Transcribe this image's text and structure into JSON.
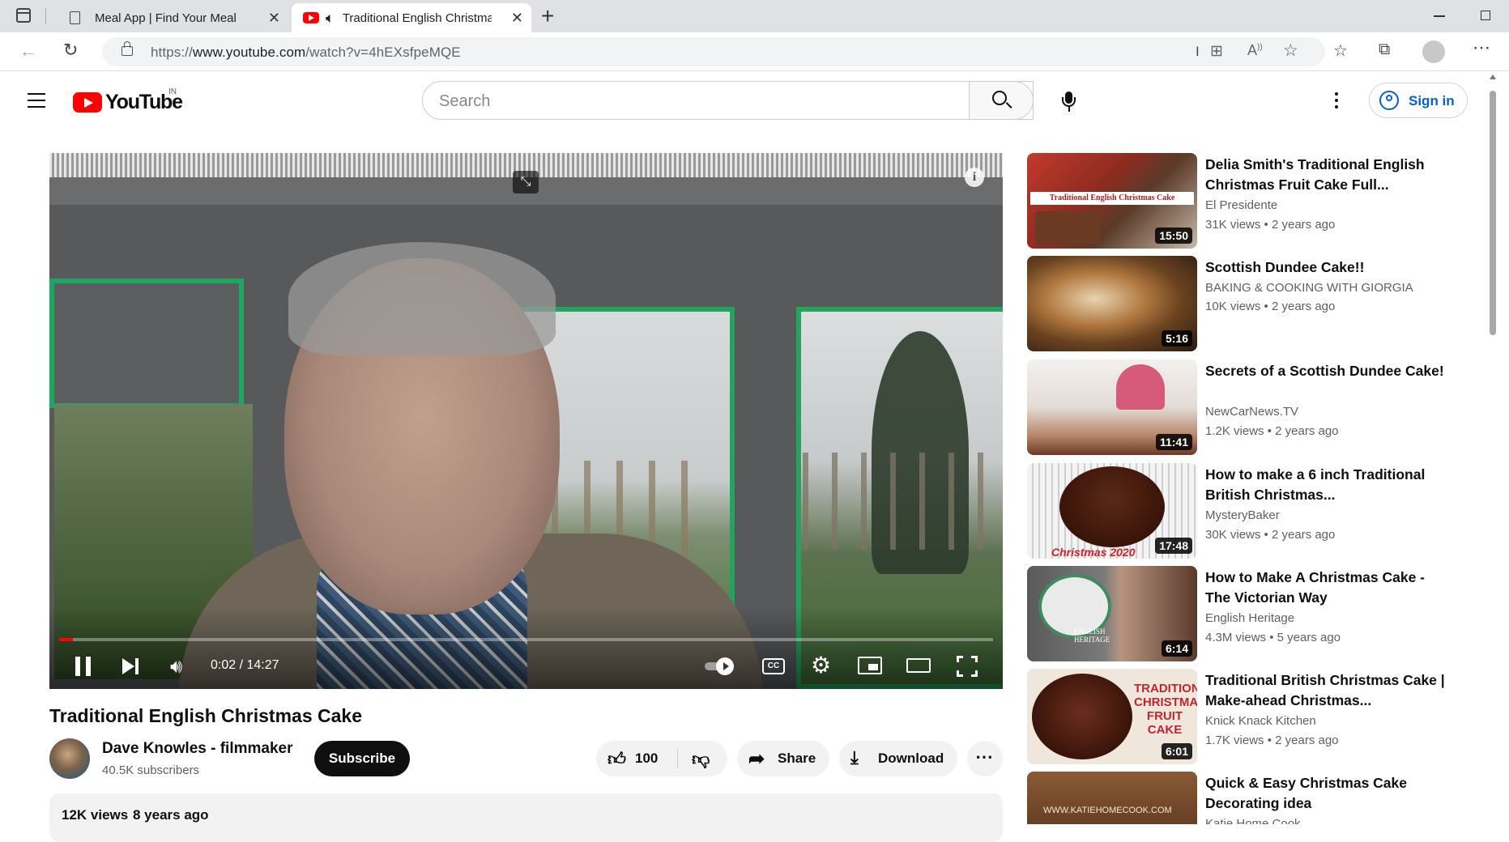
{
  "browser": {
    "tabs": [
      {
        "title": "Meal App | Find Your Meal"
      },
      {
        "title": "Traditional English Christma"
      }
    ],
    "url_prefix": "https://",
    "url_domain": "www.youtube.com",
    "url_path": "/watch?v=4hEXsfpeMQE"
  },
  "header": {
    "logo_text": "YouTube",
    "country": "IN",
    "search_placeholder": "Search",
    "signin_label": "Sign in"
  },
  "player": {
    "time": "0:02 / 14:27",
    "cc_label": "CC",
    "progress": 0.0023
  },
  "video": {
    "title": "Traditional English Christmas Cake",
    "channel": "Dave Knowles - filmmaker",
    "subscribers": "40.5K subscribers",
    "subscribe_label": "Subscribe",
    "likes": "100",
    "share_label": "Share",
    "download_label": "Download",
    "views": "12K views",
    "age": "8 years ago"
  },
  "recommendations": [
    {
      "title": "Delia Smith's Traditional English Christmas Fruit Cake Full...",
      "channel": "El Presidente",
      "views": "31K views",
      "age": "2 years ago",
      "duration": "15:50",
      "thumb_text": "Traditional English Christmas Cake"
    },
    {
      "title": "Scottish Dundee Cake!!",
      "channel": "BAKING & COOKING WITH GIORGIA",
      "views": "10K views",
      "age": "2 years ago",
      "duration": "5:16"
    },
    {
      "title": "Secrets of a Scottish Dundee Cake!",
      "channel": "NewCarNews.TV",
      "views": "1.2K views",
      "age": "2 years ago",
      "duration": "11:41"
    },
    {
      "title": "How to make a 6 inch Traditional British Christmas...",
      "channel": "MysteryBaker",
      "views": "30K views",
      "age": "2 years ago",
      "duration": "17:48",
      "thumb_text": "Christmas 2020"
    },
    {
      "title": "How to Make A Christmas Cake - The Victorian Way",
      "channel": "English Heritage",
      "views": "4.3M views",
      "age": "5 years ago",
      "duration": "6:14",
      "thumb_text": "ENGLISH HERITAGE"
    },
    {
      "title": "Traditional British Christmas Cake | Make-ahead Christmas...",
      "channel": "Knick Knack Kitchen",
      "views": "1.7K views",
      "age": "2 years ago",
      "duration": "6:01",
      "thumb_text": "TRADITIONAL CHRISTMAS FRUIT CAKE"
    },
    {
      "title": "Quick & Easy Christmas Cake Decorating idea",
      "channel": "Katie Home Cook",
      "views": "",
      "age": "",
      "duration": "",
      "thumb_text": "WWW.KATIEHOMECOOK.COM"
    }
  ],
  "colors": {
    "yt_red": "#ff0000",
    "link_blue": "#065fd4",
    "subscribe_bg": "#0f0f0f"
  }
}
